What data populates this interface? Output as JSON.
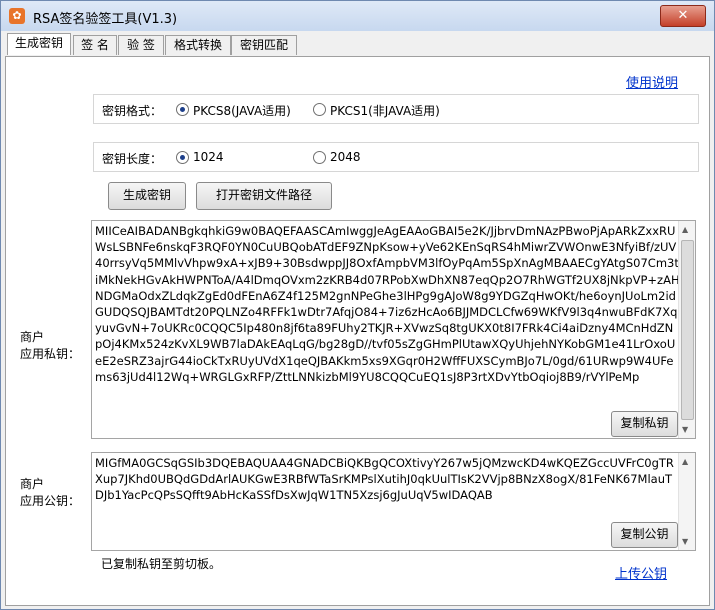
{
  "window": {
    "title": "RSA签名验签工具(V1.3)",
    "close_label": "✕"
  },
  "tabs": [
    "生成密钥",
    "签 名",
    "验 签",
    "格式转换",
    "密钥匹配"
  ],
  "help_link": "使用说明",
  "key_format": {
    "label": "密钥格式：",
    "option1": "PKCS8(JAVA适用)",
    "option2": "PKCS1(非JAVA适用)",
    "selected": "PKCS8(JAVA适用)"
  },
  "key_length": {
    "label": "密钥长度：",
    "option1": "1024",
    "option2": "2048",
    "selected": "1024"
  },
  "buttons": {
    "generate": "生成密钥",
    "open_path": "打开密钥文件路径",
    "copy_private": "复制私钥",
    "copy_public": "复制公钥"
  },
  "private_key": {
    "label_line1": "商户",
    "label_line2": "应用私钥：",
    "value": "MIICeAIBADANBgkqhkiG9w0BAQEFAASCAmIwggJeAgEAAoGBAI5e2K/JjbrvDmNAzPBwoPjApARkZxxRUWsLSBNFe6nskqF3RQF0YN0CuUBQobATdEF9ZNpKsow+yVe62KEnSqRS4hMiwrZVWOnwE3NfyiBf/zUV40rrsyVq5MMlvVhpw9xA+xJB9+30BsdwppJJ8OxfAmpbVM3lfOyPqAm5SpXnAgMBAAECgYAtgS07Cm3tiMkNekHGvAkHWPNToA/A4lDmqOVxm2zKRB4d07RPobXwDhXN87eqQp2O7RhWGTf2UX8jNkpVP+zAHNDGMaOdxZLdqkZgEd0dFEnA6Z4f125M2gnNPeGhe3lHPg9gAJoW8g9YDGZqHwOKt/he6oynJUoLm2idGUDQSQJBAMTdt20PQLNZo4RFFk1wDtr7AfqjO84+7iz6zHcAo6BJJMDCLCfw69WKfV9l3q4nwuBFdK7XqyuvGvN+7oUKRc0CQQC5Ip480n8jf6ta89FUhy2TKJR+XVwzSq8tgUKX0t8I7FRk4Ci4aiDzny4MCnHdZNpOj4KMx524zKvXL9WB7laDAkEAqLqG/bg28gD//tvf05sZgGHmPlUtawXQyUhjehNYKobGM1e41LrOxoUeE2eSRZ3ajrG44ioCkTxRUyUVdX1qeQJBAKkm5xs9XGqr0H2WffFUXSCymBJo7L/0gd/61URwp9W4UFems63jUd4l12Wq+WRGLGxRFP/ZttLNNkizbMl9YU8CQQCuEQ1sJ8P3rtXDvYtbOqioj8B9/rVYlPeMp"
  },
  "public_key": {
    "label_line1": "商户",
    "label_line2": "应用公钥：",
    "value": "MIGfMA0GCSqGSIb3DQEBAQUAA4GNADCBiQKBgQCOXtivyY267w5jQMzwcKD4wKQEZGccUVFrC0gTRXup7JKhd0UBQdGDdArlAUKGwE3RBfWTaSrKMPslXutihJ0qkUulTIsK2VVjp8BNzX8ogX/81FeNK67MlauTDJb1YacPcQPsSQfft9AbHcKaSSfDsXwJqW1TN5Xzsj6gJuUqV5wIDAQAB"
  },
  "status_text": "已复制私钥至剪切板。",
  "upload_link": "上传公钥"
}
